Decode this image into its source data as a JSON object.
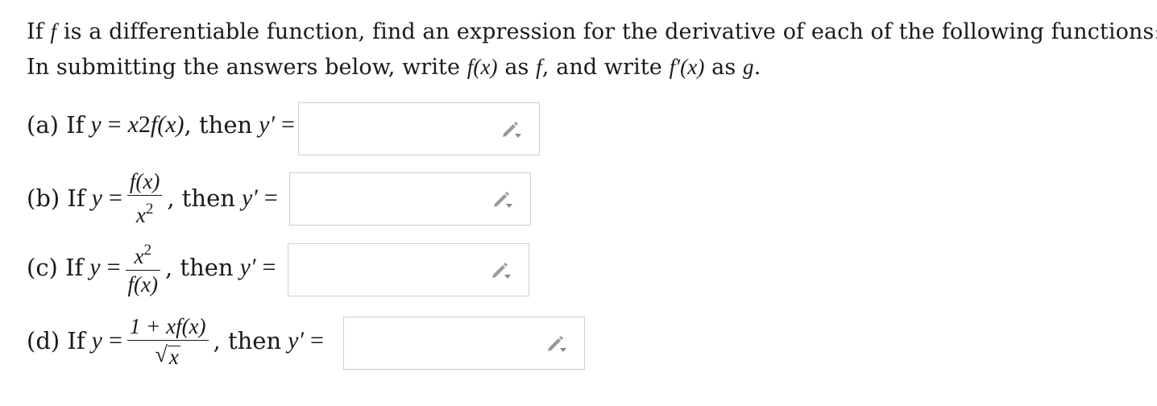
{
  "intro": {
    "line1": {
      "a": "If ",
      "f": "f",
      "b": " is a differentiable function, find an expression for the derivative of each of the following functions:"
    },
    "line2": {
      "a": "In submitting the answers below, write ",
      "fx": "f(x)",
      "b": " as ",
      "f": "f",
      "c": ", and write ",
      "fpx": "f′(x)",
      "d": " as ",
      "g": "g",
      "e": "."
    }
  },
  "problems": [
    {
      "label": "(a) If",
      "y": "y",
      "eq": "=",
      "expr": {
        "x": "x",
        "exp": "2",
        "fx": "f(x)"
      },
      "then": ", then",
      "yp": "y′",
      "eq2": "=",
      "answer": ""
    },
    {
      "label": "(b) If",
      "y": "y",
      "eq": "=",
      "num": "f(x)",
      "den": {
        "x": "x",
        "exp": "2"
      },
      "then": ", then",
      "yp": "y′",
      "eq2": "=",
      "answer": ""
    },
    {
      "label": "(c) If",
      "y": "y",
      "eq": "=",
      "num": {
        "x": "x",
        "exp": "2"
      },
      "den": "f(x)",
      "then": ", then",
      "yp": "y′",
      "eq2": "=",
      "answer": ""
    },
    {
      "label": "(d) If",
      "y": "y",
      "eq": "=",
      "num": "1 + xf(x)",
      "den": {
        "radical": "√",
        "x": "x"
      },
      "then": ", then",
      "yp": "y′",
      "eq2": "=",
      "answer": ""
    }
  ],
  "icons": {
    "answer_tool": "pencil-dropdown-icon"
  },
  "colors": {
    "text": "#1a1a1a",
    "box_border": "#cfcfcf",
    "icon": "#9a9a9a"
  }
}
